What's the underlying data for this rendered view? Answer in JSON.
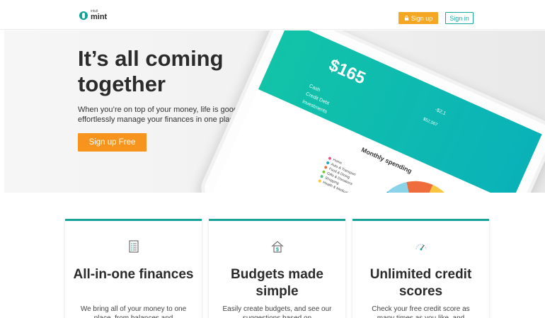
{
  "header": {
    "logo_intuit": "intuit",
    "logo_mint": "mint",
    "signup_label": "Sign up",
    "signin_label": "Sign in"
  },
  "hero": {
    "title": "It’s all coming together",
    "subtitle": "When you’re on top of your money, life is good. We help you effortlessly manage your finances in one place.",
    "cta_label": "Sign up Free"
  },
  "tablet": {
    "total": "$165",
    "small_value_1": "-$2,1",
    "small_value_2": "$52,567",
    "rows": [
      "Cash",
      "Credit Debt",
      "Investments"
    ],
    "chart_title": "Monthly spending",
    "legend": [
      {
        "label": "Home",
        "color": "#e94f8a"
      },
      {
        "label": "Auto & Transport",
        "color": "#1fa4c8"
      },
      {
        "label": "Food & Dining",
        "color": "#ef6c3c"
      },
      {
        "label": "Gifts & Donations",
        "color": "#7cc444"
      },
      {
        "label": "Shopping",
        "color": "#52c38d"
      },
      {
        "label": "Health & Medical",
        "color": "#f7c53f"
      }
    ]
  },
  "cards": [
    {
      "title": "All-in-one finances",
      "body": "We bring all of your money to one place, from balances and"
    },
    {
      "title": "Budgets made simple",
      "body": "Easily create budgets, and see our suggestions based on"
    },
    {
      "title": "Unlimited credit scores",
      "body": "Check your free credit score as many times as you like, and"
    }
  ],
  "colors": {
    "accent_teal": "#17a398",
    "accent_orange": "#f7941d",
    "signup_orange": "#f5a623"
  }
}
